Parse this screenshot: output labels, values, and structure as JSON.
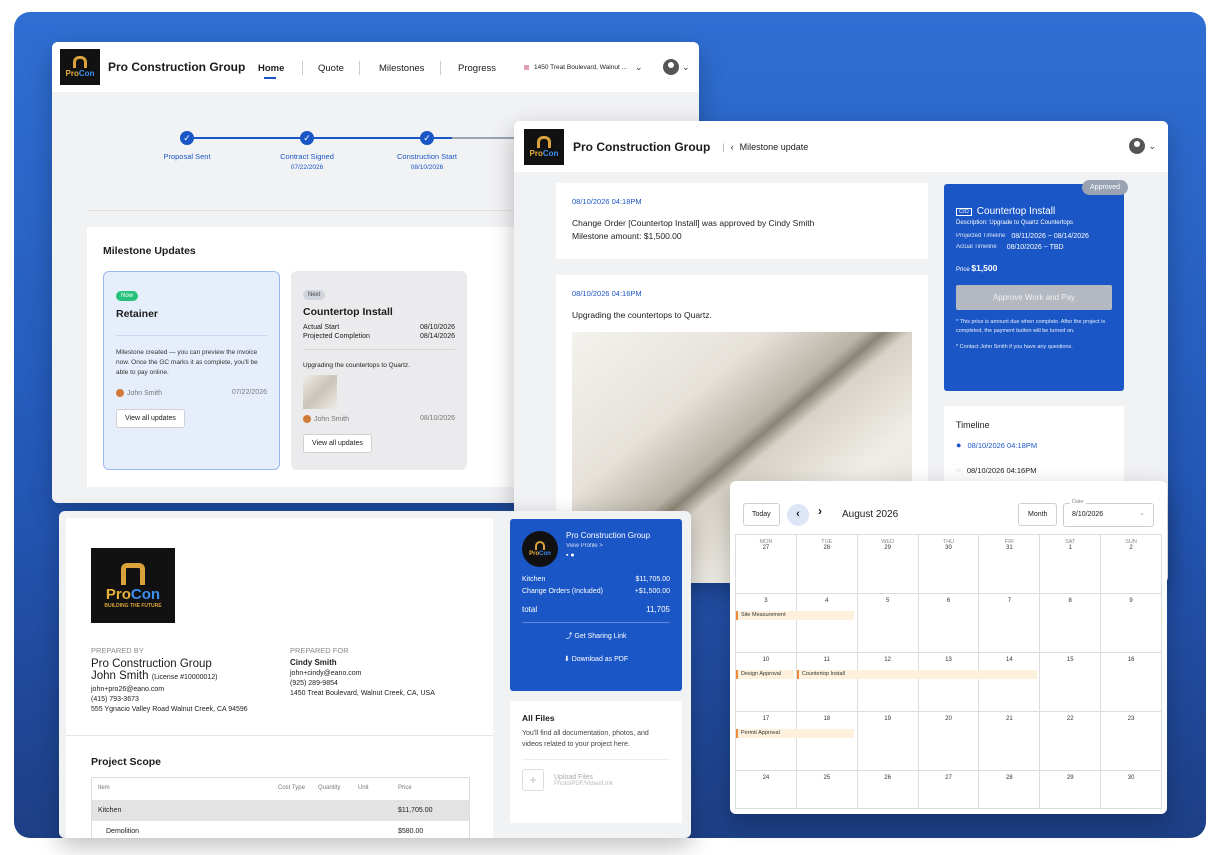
{
  "brand": {
    "name": "Pro Construction Group",
    "logo_pro": "Pro",
    "logo_con": "Con",
    "logo_tagline": "BUILDING THE FUTURE"
  },
  "home": {
    "nav": [
      "Home",
      "Quote",
      "Milestones",
      "Progress"
    ],
    "address": "1450 Treat Boulevard, Walnut ...",
    "steps": [
      {
        "label": "Proposal Sent",
        "date": ""
      },
      {
        "label": "Contract Signed",
        "date": "07/22/2026"
      },
      {
        "label": "Construction Start",
        "date": "08/10/2026"
      }
    ],
    "milestones_title": "Milestone Updates",
    "card1": {
      "badge": "Now",
      "title": "Retainer",
      "text": "Milestone created — you can preview the invoice now. Once the GC marks it as complete, you'll be able to pay online.",
      "author": "John Smith",
      "date": "07/22/2026",
      "button": "View all updates"
    },
    "card2": {
      "badge": "Next",
      "title": "Countertop Install",
      "actual_start_label": "Actual Start",
      "actual_start": "08/10/2026",
      "projected_label": "Projected Completion",
      "projected": "08/14/2026",
      "text": "Upgrading the countertops to Quartz.",
      "author": "John Smith",
      "date": "08/10/2026",
      "button": "View all updates"
    }
  },
  "milestone_update": {
    "breadcrumb": "Milestone update",
    "post1": {
      "time": "08/10/2026 04:18PM",
      "line1": "Change Order [Countertop Install] was approved by Cindy Smith",
      "line2": "Milestone amount: $1,500.00"
    },
    "post2": {
      "time": "08/10/2026 04:16PM",
      "text": "Upgrading the countertops to Quartz."
    },
    "panel": {
      "badge": "Approved",
      "co": "C/O",
      "title": "Countertop Install",
      "description": "Description: Upgrade to Quartz Countertops",
      "projected_label": "Projected Timeline",
      "projected": "08/11/2026 ~ 08/14/2026",
      "actual_label": "Actual Timeline",
      "actual": "08/10/2026 ~ TBD",
      "price_label": "Price",
      "price": "$1,500",
      "button": "Approve Work and Pay",
      "note1": "* This price is amount due when complete. After the project is completed, the payment button will be turned on.",
      "note2": "* Contact John Smith if you have any questions."
    },
    "timeline": {
      "title": "Timeline",
      "items": [
        "08/10/2026 04:18PM",
        "08/10/2026 04:16PM"
      ]
    }
  },
  "quote": {
    "prepared_by_label": "PREPARED BY",
    "company": "Pro Construction Group",
    "person": "John Smith",
    "license": "(License #10000012)",
    "email": "john+pro26@eano.com",
    "phone": "(415) 793-3673",
    "address": "555 Ygnacio Valley Road Walnut Creek, CA 94596",
    "prepared_for_label": "PREPARED FOR",
    "client": "Cindy Smith",
    "client_email": "john+cindy@eano.com",
    "client_phone": "(925) 289-9854",
    "client_address": "1450 Treat Boulevard, Walnut Creek, CA, USA",
    "scope_title": "Project Scope",
    "table_headers": [
      "Item",
      "Cost Type",
      "Quantity",
      "Unit",
      "Price"
    ],
    "rows": [
      {
        "name": "Kitchen",
        "price": "$11,705.00"
      },
      {
        "name": "Demolition",
        "price": "$580.00"
      }
    ],
    "summary": {
      "company": "Pro Construction Group",
      "view_profile": "View Profile >",
      "kitchen_label": "Kitchen",
      "kitchen": "$11,705.00",
      "co_label": "Change Orders (Included)",
      "co": "+$1,500.00",
      "total_label": "total",
      "total": "11,705",
      "share": "Get Sharing Link",
      "pdf": "Download as PDF"
    },
    "files": {
      "title": "All Files",
      "text": "You'll find all documentation, photos, and videos related to your project here.",
      "upload": "Upload Files",
      "upload_sub": "Photo/PDF/Video/Link"
    }
  },
  "calendar": {
    "today": "Today",
    "month_title": "August 2026",
    "view": "Month",
    "date_label": "Date",
    "date_value": "8/10/2026",
    "days": [
      "MON",
      "TUE",
      "WED",
      "THU",
      "FRI",
      "SAT",
      "SUN"
    ],
    "weeks": [
      [
        "27",
        "28",
        "29",
        "30",
        "31",
        "1",
        "2"
      ],
      [
        "3",
        "4",
        "5",
        "6",
        "7",
        "8",
        "9"
      ],
      [
        "10",
        "11",
        "12",
        "13",
        "14",
        "15",
        "16"
      ],
      [
        "17",
        "18",
        "19",
        "20",
        "21",
        "22",
        "23"
      ],
      [
        "24",
        "25",
        "26",
        "27",
        "28",
        "29",
        "30"
      ]
    ],
    "events": [
      "Site Measurement",
      "Design Approval",
      "Countertop Install",
      "Permit Approval"
    ]
  },
  "colors": {
    "primary": "#1b56c6",
    "accent": "#ef8a3a",
    "success": "#27c27a"
  }
}
